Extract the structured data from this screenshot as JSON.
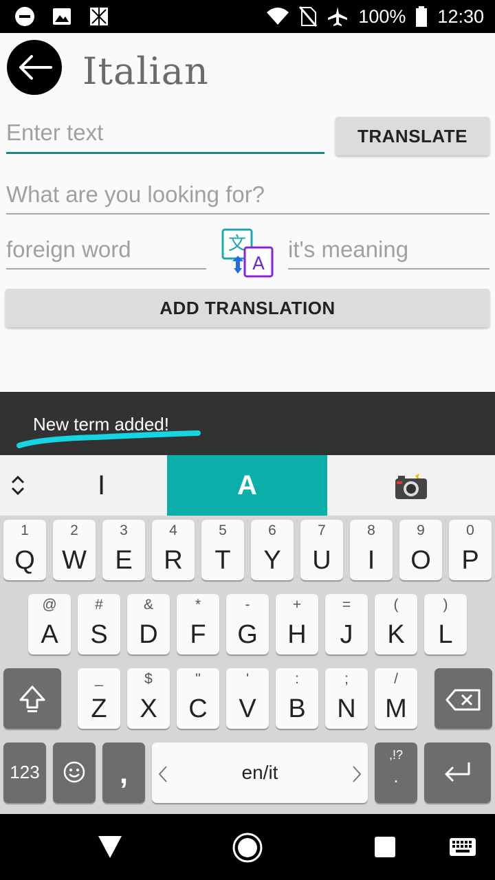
{
  "status": {
    "battery": "100%",
    "time": "12:30"
  },
  "app": {
    "title": "Italian"
  },
  "form": {
    "enter_text_placeholder": "Enter text",
    "translate_label": "TRANSLATE",
    "search_placeholder": "What are you looking for?",
    "foreign_placeholder": "foreign word",
    "meaning_placeholder": "it's meaning",
    "add_translation_label": "ADD TRANSLATION"
  },
  "snackbar": {
    "message": "New term added!",
    "highlight_color": "#17d4e3"
  },
  "keyboard": {
    "suggestions": [
      "I",
      "A"
    ],
    "row1": [
      {
        "hint": "1",
        "key": "Q"
      },
      {
        "hint": "2",
        "key": "W"
      },
      {
        "hint": "3",
        "key": "E"
      },
      {
        "hint": "4",
        "key": "R"
      },
      {
        "hint": "5",
        "key": "T"
      },
      {
        "hint": "6",
        "key": "Y"
      },
      {
        "hint": "7",
        "key": "U"
      },
      {
        "hint": "8",
        "key": "I"
      },
      {
        "hint": "9",
        "key": "O"
      },
      {
        "hint": "0",
        "key": "P"
      }
    ],
    "row2": [
      {
        "hint": "@",
        "key": "A"
      },
      {
        "hint": "#",
        "key": "S"
      },
      {
        "hint": "&",
        "key": "D"
      },
      {
        "hint": "*",
        "key": "F"
      },
      {
        "hint": "-",
        "key": "G"
      },
      {
        "hint": "+",
        "key": "H"
      },
      {
        "hint": "=",
        "key": "J"
      },
      {
        "hint": "(",
        "key": "K"
      },
      {
        "hint": ")",
        "key": "L"
      }
    ],
    "row3": [
      {
        "hint": "_",
        "key": "Z"
      },
      {
        "hint": "$",
        "key": "X"
      },
      {
        "hint": "\"",
        "key": "C"
      },
      {
        "hint": "'",
        "key": "V"
      },
      {
        "hint": ":",
        "key": "B"
      },
      {
        "hint": ";",
        "key": "N"
      },
      {
        "hint": "/",
        "key": "M"
      }
    ],
    "numbers_label": "123",
    "comma_label": ",",
    "space_label": "en/it",
    "punct_hint": ",!?",
    "punct_label": ".",
    "accent_color": "#0aafaa"
  }
}
